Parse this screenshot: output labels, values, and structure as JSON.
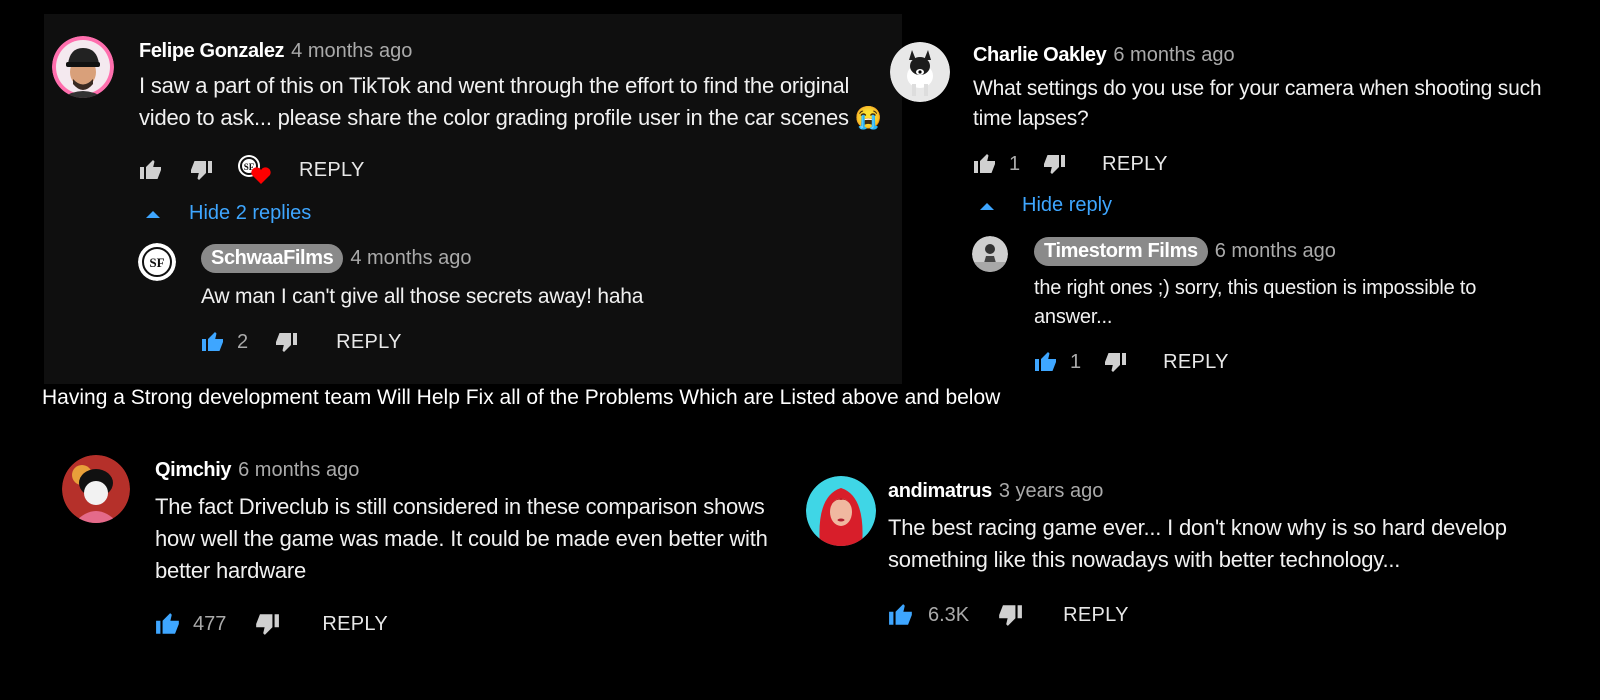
{
  "banner": {
    "text": "Having a Strong development team Will Help Fix all of the Problems Which are Listed above and below"
  },
  "icons": {
    "like": "thumbs-up-icon",
    "dislike": "thumbs-down-icon",
    "caret": "caret-up-icon",
    "heart_badge": "creator-heart-icon",
    "liked_color": "#3ea6ff",
    "inactive_color": "#d0d0d0"
  },
  "comments": [
    {
      "author": "Felipe Gonzalez",
      "ago": "4 months ago",
      "text": "I saw a part of this on TikTok and went through the effort to find the original video to ask... please share the color grading profile user in the car scenes 😭",
      "likes": "",
      "reply_label": "REPLY",
      "toggle_label": "Hide 2 replies",
      "replies": [
        {
          "author": "SchwaaFilms",
          "ago": "4 months ago",
          "text": "Aw man I can't give all those secrets away! haha",
          "likes": "2",
          "reply_label": "REPLY"
        }
      ]
    },
    {
      "author": "Charlie Oakley",
      "ago": "6 months ago",
      "text": "What settings do you use for your camera when shooting such time lapses?",
      "likes": "1",
      "reply_label": "REPLY",
      "toggle_label": "Hide reply",
      "replies": [
        {
          "author": "Timestorm Films",
          "ago": "6 months ago",
          "text": "the right ones ;) sorry, this question is impossible to answer...",
          "likes": "1",
          "reply_label": "REPLY"
        }
      ]
    },
    {
      "author": "Qimchiy",
      "ago": "6 months ago",
      "text": "The fact Driveclub is still considered in these comparison shows how well the game was made. It could be made even better with better hardware",
      "likes": "477",
      "reply_label": "REPLY"
    },
    {
      "author": "andimatrus",
      "ago": "3 years ago",
      "text": "The best racing game ever... I don't know why is so hard develop something like this nowadays with better technology...",
      "likes": "6.3K",
      "reply_label": "REPLY"
    }
  ]
}
